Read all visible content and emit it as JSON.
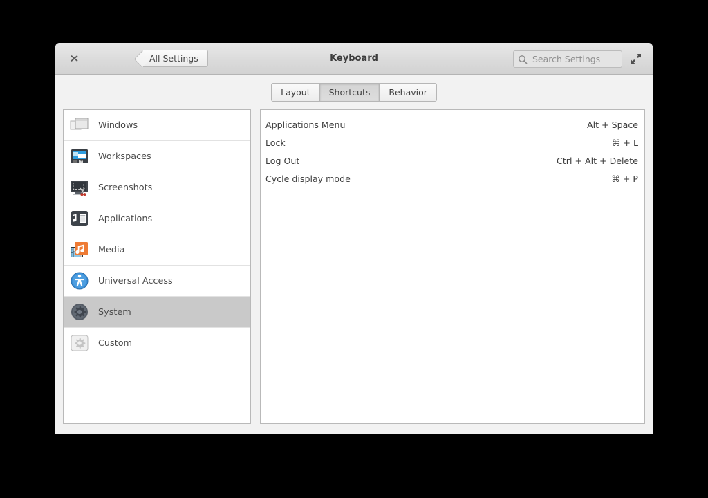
{
  "window": {
    "title": "Keyboard",
    "close_icon": "close-icon",
    "fullscreen_icon": "fullscreen-icon",
    "back_label": "All Settings"
  },
  "search": {
    "placeholder": "Search Settings",
    "value": "",
    "icon": "search-icon"
  },
  "tabs": [
    {
      "label": "Layout",
      "active": false
    },
    {
      "label": "Shortcuts",
      "active": true
    },
    {
      "label": "Behavior",
      "active": false
    }
  ],
  "sidebar": {
    "items": [
      {
        "label": "Windows",
        "icon": "windows-icon",
        "selected": false
      },
      {
        "label": "Workspaces",
        "icon": "workspaces-icon",
        "selected": false
      },
      {
        "label": "Screenshots",
        "icon": "screenshots-icon",
        "selected": false
      },
      {
        "label": "Applications",
        "icon": "applications-icon",
        "selected": false
      },
      {
        "label": "Media",
        "icon": "media-icon",
        "selected": false
      },
      {
        "label": "Universal Access",
        "icon": "universal-access-icon",
        "selected": false
      },
      {
        "label": "System",
        "icon": "system-gear-icon",
        "selected": true
      },
      {
        "label": "Custom",
        "icon": "custom-gear-icon",
        "selected": false
      }
    ]
  },
  "shortcuts": {
    "rows": [
      {
        "name": "Applications Menu",
        "accel": "Alt + Space"
      },
      {
        "name": "Lock",
        "accel": "⌘ + L"
      },
      {
        "name": "Log Out",
        "accel": "Ctrl + Alt + Delete"
      },
      {
        "name": "Cycle display mode",
        "accel": "⌘ + P"
      }
    ]
  },
  "colors": {
    "selection": "#c9c9c9",
    "accent_blue": "#3b8fd8",
    "accent_orange": "#ee7b34",
    "panel_bg": "#f2f2f2",
    "text": "#4b4b4b"
  }
}
